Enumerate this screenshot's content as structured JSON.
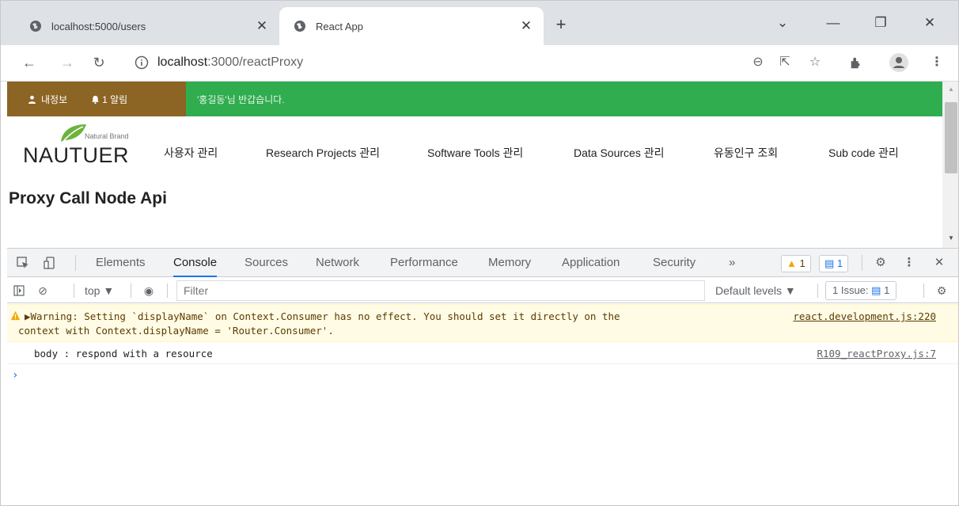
{
  "tabs": [
    {
      "title": "localhost:5000/users",
      "icon": "globe-icon"
    },
    {
      "title": "React App",
      "icon": "globe-icon"
    }
  ],
  "toolbar": {
    "url_host": "localhost",
    "url_path": ":3000/reactProxy"
  },
  "page": {
    "topbar": {
      "my_info": "내정보",
      "alerts": "1 알림",
      "greeting": "'홍길동'님 반갑습니다."
    },
    "logo": {
      "brand": "NAUTUER",
      "tagline": "Natural Brand"
    },
    "menu": [
      "사용자 관리",
      "Research Projects 관리",
      "Software Tools 관리",
      "Data Sources 관리",
      "유동인구 조회",
      "Sub code 관리"
    ],
    "title": "Proxy Call Node Api"
  },
  "devtools": {
    "tabs": [
      "Elements",
      "Console",
      "Sources",
      "Network",
      "Performance",
      "Memory",
      "Application",
      "Security"
    ],
    "more": "»",
    "warn_count": "1",
    "info_count": "1",
    "filter": {
      "context": "top ▼",
      "placeholder": "Filter",
      "levels": "Default levels ▼",
      "issues_label": "1 Issue:",
      "issues_count": "1"
    },
    "messages": {
      "warning_line1": "▶Warning: Setting `displayName` on Context.Consumer has no effect. You should set it directly on the",
      "warning_line2": "context with Context.displayName = 'Router.Consumer'.",
      "warning_source": "react.development.js:220",
      "log_text": "body : respond with a resource",
      "log_source": "R109_reactProxy.js:7"
    },
    "prompt": "›"
  },
  "colors": {
    "topbar_green": "#2fad4f",
    "userbox_brown": "#8c6424",
    "accent_blue": "#1a73e8",
    "warning_bg": "#fffbe5"
  }
}
